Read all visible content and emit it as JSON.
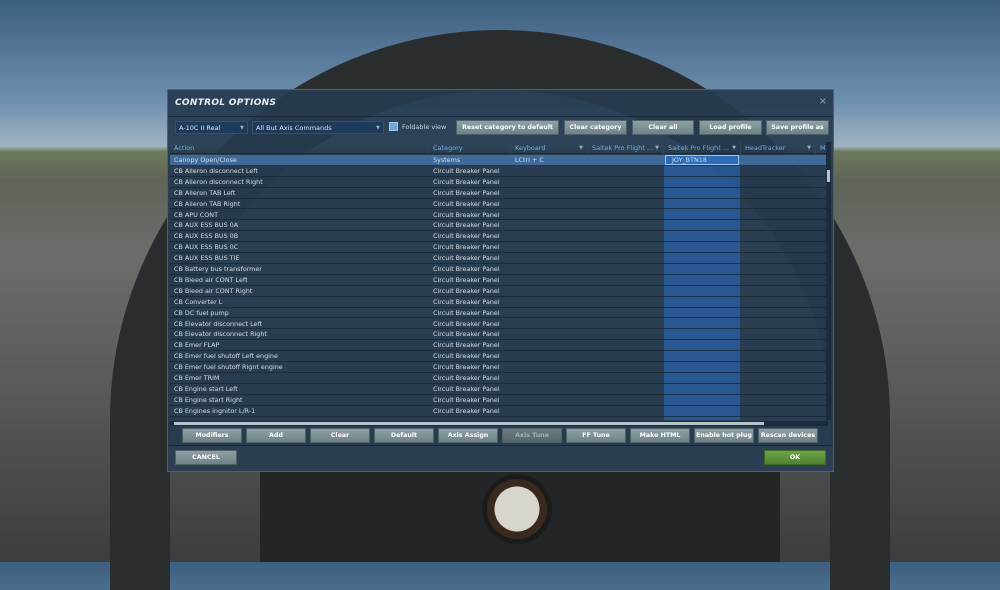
{
  "dialog": {
    "title": "CONTROL OPTIONS",
    "close": "×"
  },
  "toolbar": {
    "aircraft": "A-10C II Real",
    "filter": "All But Axis Commands",
    "foldable_label": "Foldable view",
    "foldable_checked": true,
    "buttons": [
      "Reset category to default",
      "Clear category",
      "Clear all",
      "Load profile",
      "Save profile as"
    ]
  },
  "columns": [
    "Action",
    "Category",
    "Keyboard",
    "Saitek Pro Flight ...",
    "Saitek Pro Flight ...",
    "HeadTracker",
    "M"
  ],
  "rows": [
    {
      "action": "Canopy Open/Close",
      "category": "Systems",
      "keyboard": "LCtrl + C",
      "saitek2": "JOY_BTN18",
      "selected": true
    },
    {
      "action": "CB Aileron disconnect Left",
      "category": "Circuit Breaker Panel"
    },
    {
      "action": "CB Aileron disconnect Right",
      "category": "Circuit Breaker Panel"
    },
    {
      "action": "CB Aileron TAB Left",
      "category": "Circuit Breaker Panel"
    },
    {
      "action": "CB Aileron TAB Right",
      "category": "Circuit Breaker Panel"
    },
    {
      "action": "CB APU CONT",
      "category": "Circuit Breaker Panel"
    },
    {
      "action": "CB AUX ESS BUS 0A",
      "category": "Circuit Breaker Panel"
    },
    {
      "action": "CB AUX ESS BUS 0B",
      "category": "Circuit Breaker Panel"
    },
    {
      "action": "CB AUX ESS BUS 0C",
      "category": "Circuit Breaker Panel"
    },
    {
      "action": "CB AUX ESS BUS TIE",
      "category": "Circuit Breaker Panel"
    },
    {
      "action": "CB Battery bus transformer",
      "category": "Circuit Breaker Panel"
    },
    {
      "action": "CB Bleed air CONT Left",
      "category": "Circuit Breaker Panel"
    },
    {
      "action": "CB Bleed air CONT Right",
      "category": "Circuit Breaker Panel"
    },
    {
      "action": "CB Converter L",
      "category": "Circuit Breaker Panel"
    },
    {
      "action": "CB DC fuel pump",
      "category": "Circuit Breaker Panel"
    },
    {
      "action": "CB Elevator disconnect Left",
      "category": "Circuit Breaker Panel"
    },
    {
      "action": "CB Elevator disconnect Right",
      "category": "Circuit Breaker Panel"
    },
    {
      "action": "CB Emer FLAP",
      "category": "Circuit Breaker Panel"
    },
    {
      "action": "CB Emer fuel shutoff Left engine",
      "category": "Circuit Breaker Panel"
    },
    {
      "action": "CB Emer fuel shutoff Rignt engine",
      "category": "Circuit Breaker Panel"
    },
    {
      "action": "CB Emer TRIM",
      "category": "Circuit Breaker Panel"
    },
    {
      "action": "CB Engine start Left",
      "category": "Circuit Breaker Panel"
    },
    {
      "action": "CB Engine start Right",
      "category": "Circuit Breaker Panel"
    },
    {
      "action": "CB Engines ingnitor L/R-1",
      "category": "Circuit Breaker Panel"
    }
  ],
  "bottom_buttons": [
    "Modifiers",
    "Add",
    "Clear",
    "Default",
    "Axis Assign",
    "Axis Tune",
    "FF Tune",
    "Make HTML",
    "Enable hot plug",
    "Rescan devices"
  ],
  "footer": {
    "cancel": "CANCEL",
    "ok": "OK"
  }
}
